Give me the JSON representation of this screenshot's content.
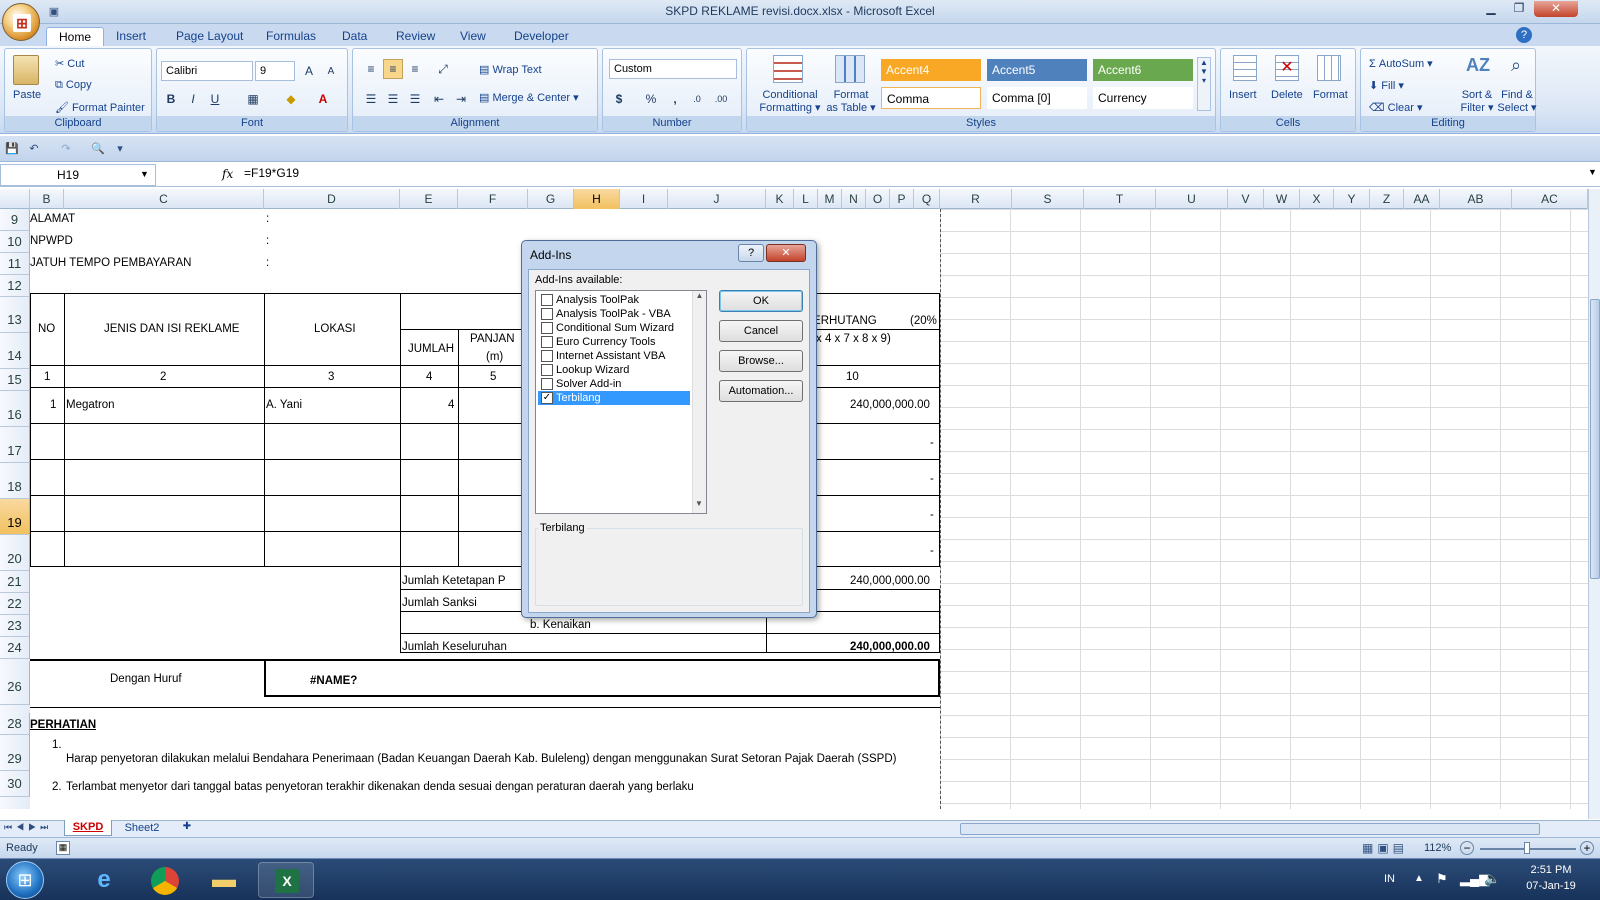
{
  "window": {
    "title": "SKPD REKLAME revisi.docx.xlsx - Microsoft Excel"
  },
  "tabs": [
    "Home",
    "Insert",
    "Page Layout",
    "Formulas",
    "Data",
    "Review",
    "View",
    "Developer"
  ],
  "ribbon": {
    "clipboard": {
      "title": "Clipboard",
      "paste": "Paste",
      "cut": "Cut",
      "copy": "Copy",
      "format_painter": "Format Painter"
    },
    "font": {
      "title": "Font",
      "name": "Calibri",
      "size": "9"
    },
    "alignment": {
      "title": "Alignment",
      "wrap": "Wrap Text",
      "merge": "Merge & Center"
    },
    "number": {
      "title": "Number",
      "format": "Custom"
    },
    "styles": {
      "title": "Styles",
      "conditional": "Conditional",
      "conditional2": "Formatting",
      "format_table": "Format",
      "format_table2": "as Table",
      "accent4": "Accent4",
      "accent5": "Accent5",
      "accent6": "Accent6",
      "comma": "Comma",
      "comma0": "Comma [0]",
      "currency": "Currency"
    },
    "cells": {
      "title": "Cells",
      "insert": "Insert",
      "delete": "Delete",
      "format": "Format"
    },
    "editing": {
      "title": "Editing",
      "autosum": "AutoSum",
      "fill": "Fill",
      "clear": "Clear",
      "sort": "Sort &",
      "sort2": "Filter",
      "find": "Find &",
      "find2": "Select"
    }
  },
  "formula_bar": {
    "name": "H19",
    "fx": "fx",
    "formula": "=F19*G19"
  },
  "columns": [
    "B",
    "C",
    "D",
    "E",
    "F",
    "G",
    "H",
    "I",
    "J",
    "K",
    "L",
    "M",
    "N",
    "O",
    "P",
    "Q",
    "R",
    "S",
    "T",
    "U",
    "V",
    "W",
    "X",
    "Y",
    "Z",
    "AA",
    "AB",
    "AC"
  ],
  "rows": [
    "9",
    "10",
    "11",
    "12",
    "13",
    "14",
    "15",
    "16",
    "17",
    "18",
    "19",
    "20",
    "21",
    "22",
    "23",
    "24",
    "26",
    "28",
    "29",
    "30"
  ],
  "sheet": {
    "alamat": "ALAMAT",
    "npwpd": "NPWPD",
    "jatuh": "JATUH TEMPO PEMBAYARAN",
    "colon": ":",
    "no": "NO",
    "jenis": "JENIS DAN ISI REKLAME",
    "lokasi": "LOKASI",
    "jumlah": "JUMLAH",
    "panjang": "PANJAN",
    "m": "(m)",
    "terhutang": "TERHUTANG",
    "pct": "(20%",
    "formula_txt": "x 4 x 7 x 8 x 9)",
    "n1": "1",
    "n2": "2",
    "n3": "3",
    "n4": "4",
    "n5": "5",
    "n10": "10",
    "r16_no": "1",
    "r16_jenis": "Megatron",
    "r16_lokasi": "A. Yani",
    "r16_jumlah": "4",
    "r16_total": "240,000,000.00",
    "dash": "-",
    "jk": "Jumlah Ketetapan P",
    "jk_val": "240,000,000.00",
    "js": "Jumlah Sanksi",
    "kenaikan": "b. Kenaikan",
    "jkel": "Jumlah Keseluruhan",
    "jkel_val": "240,000,000.00",
    "huruf": "Dengan Huruf",
    "name_err": "#NAME?",
    "perhatian": "PERHATIAN",
    "p1": "1.",
    "p1_text": "Harap penyetoran dilakukan melalui Bendahara Penerimaan (Badan Keuangan Daerah Kab. Buleleng) dengan menggunakan Surat Setoran Pajak Daerah (SSPD)",
    "p2": "2.",
    "p2_text": "Terlambat menyetor dari tanggal batas penyetoran terakhir dikenakan denda sesuai dengan peraturan daerah yang berlaku"
  },
  "dialog": {
    "title": "Add-Ins",
    "help": "?",
    "close": "✕",
    "available": "Add-Ins available:",
    "items": [
      {
        "label": "Analysis ToolPak",
        "checked": false
      },
      {
        "label": "Analysis ToolPak - VBA",
        "checked": false
      },
      {
        "label": "Conditional Sum Wizard",
        "checked": false
      },
      {
        "label": "Euro Currency Tools",
        "checked": false
      },
      {
        "label": "Internet Assistant VBA",
        "checked": false
      },
      {
        "label": "Lookup Wizard",
        "checked": false
      },
      {
        "label": "Solver Add-in",
        "checked": false
      },
      {
        "label": "Terbilang",
        "checked": true
      }
    ],
    "ok": "OK",
    "cancel": "Cancel",
    "browse": "Browse...",
    "automation": "Automation...",
    "desc": "Terbilang"
  },
  "sheet_tabs": [
    "SKPD",
    "Sheet2"
  ],
  "status": {
    "ready": "Ready",
    "zoom": "112%"
  },
  "taskbar": {
    "lang": "IN",
    "time": "2:51 PM",
    "date": "07-Jan-19"
  }
}
